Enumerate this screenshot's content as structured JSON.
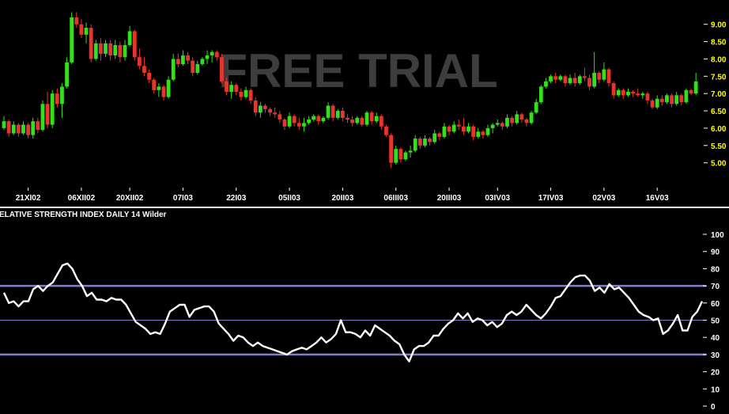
{
  "watermark": "FREE TRIAL",
  "chart_data": [
    {
      "type": "candlestick",
      "panel": "price",
      "ylim": [
        4.75,
        9.35
      ],
      "y_ticks": [
        "5.00",
        "5.50",
        "6.00",
        "6.50",
        "7.00",
        "7.50",
        "8.00",
        "8.50",
        "9.00"
      ],
      "x_ticks": [
        {
          "label": "21XI02",
          "index": 5
        },
        {
          "label": "06XII02",
          "index": 16
        },
        {
          "label": "20XII02",
          "index": 26
        },
        {
          "label": "07I03",
          "index": 37
        },
        {
          "label": "22I03",
          "index": 48
        },
        {
          "label": "05II03",
          "index": 59
        },
        {
          "label": "20II03",
          "index": 70
        },
        {
          "label": "06III03",
          "index": 81
        },
        {
          "label": "20III03",
          "index": 92
        },
        {
          "label": "03IV03",
          "index": 102
        },
        {
          "label": "17IV03",
          "index": 113
        },
        {
          "label": "02V03",
          "index": 124
        },
        {
          "label": "16V03",
          "index": 135
        }
      ],
      "colors": {
        "up": "#33e11a",
        "down": "#e8352c",
        "ticks": "#ffff00",
        "dates": "#ffffff"
      },
      "candles": [
        [
          6.0,
          6.35,
          5.95,
          6.2
        ],
        [
          6.2,
          6.25,
          5.75,
          5.85
        ],
        [
          5.85,
          6.2,
          5.8,
          6.1
        ],
        [
          6.1,
          6.15,
          5.75,
          5.85
        ],
        [
          5.85,
          6.2,
          5.8,
          6.1
        ],
        [
          6.1,
          6.15,
          5.7,
          5.8
        ],
        [
          5.8,
          6.3,
          5.7,
          6.2
        ],
        [
          6.2,
          6.3,
          5.85,
          5.95
        ],
        [
          5.95,
          6.8,
          5.9,
          6.7
        ],
        [
          6.7,
          7.05,
          6.0,
          6.1
        ],
        [
          6.1,
          7.1,
          6.0,
          7.0
        ],
        [
          7.0,
          7.15,
          6.6,
          6.7
        ],
        [
          6.7,
          7.3,
          6.3,
          7.2
        ],
        [
          7.2,
          8.05,
          7.15,
          7.9
        ],
        [
          7.9,
          9.35,
          7.85,
          9.2
        ],
        [
          9.2,
          9.35,
          8.9,
          9.0
        ],
        [
          9.0,
          9.15,
          8.6,
          8.7
        ],
        [
          8.7,
          9.05,
          8.45,
          8.9
        ],
        [
          8.9,
          9.0,
          7.9,
          8.0
        ],
        [
          8.0,
          8.55,
          7.95,
          8.45
        ],
        [
          8.45,
          8.6,
          7.95,
          8.15
        ],
        [
          8.15,
          8.55,
          8.05,
          8.45
        ],
        [
          8.45,
          8.55,
          7.95,
          8.1
        ],
        [
          8.1,
          8.55,
          8.0,
          8.4
        ],
        [
          8.4,
          8.5,
          7.9,
          8.05
        ],
        [
          8.05,
          8.55,
          7.95,
          8.4
        ],
        [
          8.4,
          8.95,
          8.35,
          8.8
        ],
        [
          8.8,
          8.85,
          7.95,
          8.05
        ],
        [
          8.05,
          8.3,
          7.7,
          7.8
        ],
        [
          7.8,
          8.05,
          7.5,
          7.6
        ],
        [
          7.6,
          7.7,
          7.3,
          7.4
        ],
        [
          7.4,
          7.45,
          7.0,
          7.1
        ],
        [
          7.1,
          7.3,
          6.9,
          7.2
        ],
        [
          7.2,
          7.25,
          6.8,
          6.9
        ],
        [
          6.9,
          7.5,
          6.85,
          7.4
        ],
        [
          7.4,
          8.15,
          7.35,
          8.0
        ],
        [
          8.0,
          8.15,
          7.75,
          7.85
        ],
        [
          7.85,
          8.25,
          7.8,
          8.1
        ],
        [
          8.1,
          8.2,
          7.85,
          7.95
        ],
        [
          7.95,
          8.05,
          7.5,
          7.6
        ],
        [
          7.6,
          7.95,
          7.55,
          7.85
        ],
        [
          7.85,
          8.05,
          7.8,
          8.0
        ],
        [
          8.0,
          8.25,
          7.85,
          8.1
        ],
        [
          8.1,
          8.25,
          7.9,
          8.2
        ],
        [
          8.2,
          8.25,
          7.95,
          8.05
        ],
        [
          8.05,
          8.15,
          7.3,
          7.35
        ],
        [
          7.35,
          7.45,
          6.95,
          7.05
        ],
        [
          7.05,
          7.35,
          6.85,
          7.25
        ],
        [
          7.25,
          7.3,
          6.95,
          7.05
        ],
        [
          7.05,
          7.15,
          6.8,
          6.9
        ],
        [
          6.9,
          7.2,
          6.85,
          7.1
        ],
        [
          7.1,
          7.15,
          6.7,
          6.8
        ],
        [
          6.8,
          6.9,
          6.35,
          6.45
        ],
        [
          6.45,
          6.75,
          6.3,
          6.65
        ],
        [
          6.65,
          6.7,
          6.45,
          6.55
        ],
        [
          6.55,
          6.6,
          6.35,
          6.45
        ],
        [
          6.45,
          6.6,
          6.3,
          6.4
        ],
        [
          6.4,
          6.5,
          6.15,
          6.25
        ],
        [
          6.25,
          6.3,
          5.95,
          6.05
        ],
        [
          6.05,
          6.45,
          6.0,
          6.35
        ],
        [
          6.35,
          6.4,
          6.05,
          6.15
        ],
        [
          6.15,
          6.3,
          5.95,
          6.05
        ],
        [
          6.05,
          6.3,
          5.9,
          6.15
        ],
        [
          6.15,
          6.35,
          6.1,
          6.25
        ],
        [
          6.25,
          6.4,
          6.2,
          6.35
        ],
        [
          6.35,
          6.4,
          6.1,
          6.2
        ],
        [
          6.2,
          6.35,
          6.15,
          6.3
        ],
        [
          6.3,
          6.75,
          6.25,
          6.65
        ],
        [
          6.65,
          6.7,
          6.2,
          6.3
        ],
        [
          6.3,
          6.55,
          6.25,
          6.5
        ],
        [
          6.5,
          6.6,
          6.2,
          6.3
        ],
        [
          6.3,
          6.4,
          6.15,
          6.25
        ],
        [
          6.25,
          6.35,
          6.05,
          6.15
        ],
        [
          6.15,
          6.35,
          6.1,
          6.3
        ],
        [
          6.3,
          6.35,
          6.05,
          6.1
        ],
        [
          6.1,
          6.5,
          6.05,
          6.45
        ],
        [
          6.45,
          6.5,
          6.1,
          6.2
        ],
        [
          6.2,
          6.45,
          6.15,
          6.35
        ],
        [
          6.35,
          6.4,
          5.95,
          6.05
        ],
        [
          6.05,
          6.1,
          5.75,
          5.8
        ],
        [
          5.8,
          5.85,
          4.85,
          5.0
        ],
        [
          5.0,
          5.5,
          4.95,
          5.4
        ],
        [
          5.4,
          5.45,
          5.0,
          5.1
        ],
        [
          5.1,
          5.35,
          5.05,
          5.3
        ],
        [
          5.3,
          5.5,
          5.15,
          5.35
        ],
        [
          5.35,
          5.8,
          5.3,
          5.7
        ],
        [
          5.7,
          5.75,
          5.4,
          5.5
        ],
        [
          5.5,
          5.8,
          5.45,
          5.7
        ],
        [
          5.7,
          5.75,
          5.5,
          5.6
        ],
        [
          5.6,
          5.95,
          5.55,
          5.85
        ],
        [
          5.85,
          5.9,
          5.65,
          5.75
        ],
        [
          5.75,
          6.15,
          5.7,
          6.05
        ],
        [
          6.05,
          6.1,
          5.8,
          5.9
        ],
        [
          5.9,
          6.2,
          5.85,
          6.1
        ],
        [
          6.1,
          6.25,
          5.95,
          6.05
        ],
        [
          6.05,
          6.3,
          5.8,
          5.9
        ],
        [
          5.9,
          6.15,
          5.85,
          6.05
        ],
        [
          6.05,
          6.1,
          5.65,
          5.75
        ],
        [
          5.75,
          6.0,
          5.7,
          5.9
        ],
        [
          5.9,
          5.95,
          5.7,
          5.8
        ],
        [
          5.8,
          6.1,
          5.75,
          6.0
        ],
        [
          6.0,
          6.15,
          5.85,
          6.1
        ],
        [
          6.1,
          6.25,
          6.05,
          6.15
        ],
        [
          6.15,
          6.2,
          5.95,
          6.05
        ],
        [
          6.05,
          6.4,
          6.0,
          6.3
        ],
        [
          6.3,
          6.35,
          6.05,
          6.15
        ],
        [
          6.15,
          6.5,
          6.1,
          6.4
        ],
        [
          6.4,
          6.45,
          6.15,
          6.25
        ],
        [
          6.25,
          6.3,
          6.05,
          6.15
        ],
        [
          6.15,
          6.5,
          6.1,
          6.45
        ],
        [
          6.45,
          6.85,
          6.4,
          6.75
        ],
        [
          6.75,
          7.25,
          6.7,
          7.2
        ],
        [
          7.2,
          7.45,
          7.15,
          7.35
        ],
        [
          7.35,
          7.55,
          7.3,
          7.5
        ],
        [
          7.5,
          7.6,
          7.3,
          7.4
        ],
        [
          7.4,
          7.55,
          7.35,
          7.5
        ],
        [
          7.5,
          7.55,
          7.2,
          7.3
        ],
        [
          7.3,
          7.55,
          7.25,
          7.45
        ],
        [
          7.45,
          7.6,
          7.2,
          7.3
        ],
        [
          7.3,
          7.55,
          7.25,
          7.5
        ],
        [
          7.5,
          7.75,
          7.35,
          7.45
        ],
        [
          7.45,
          7.55,
          7.1,
          7.2
        ],
        [
          7.2,
          8.2,
          7.15,
          7.6
        ],
        [
          7.6,
          7.65,
          7.3,
          7.4
        ],
        [
          7.4,
          7.9,
          7.35,
          7.7
        ],
        [
          7.7,
          7.75,
          7.2,
          7.3
        ],
        [
          7.3,
          7.35,
          6.85,
          6.95
        ],
        [
          6.95,
          7.15,
          6.9,
          7.1
        ],
        [
          7.1,
          7.15,
          6.85,
          6.95
        ],
        [
          6.95,
          7.15,
          6.9,
          7.05
        ],
        [
          7.05,
          7.1,
          6.9,
          7.0
        ],
        [
          7.0,
          7.15,
          6.9,
          6.95
        ],
        [
          6.95,
          7.05,
          6.85,
          7.0
        ],
        [
          7.0,
          7.05,
          6.7,
          6.8
        ],
        [
          6.8,
          6.85,
          6.55,
          6.6
        ],
        [
          6.6,
          6.95,
          6.55,
          6.85
        ],
        [
          6.85,
          6.95,
          6.65,
          6.75
        ],
        [
          6.75,
          7.0,
          6.7,
          6.95
        ],
        [
          6.95,
          7.0,
          6.6,
          6.7
        ],
        [
          6.7,
          7.05,
          6.65,
          6.95
        ],
        [
          6.95,
          7.0,
          6.65,
          6.75
        ],
        [
          6.75,
          7.15,
          6.7,
          7.1
        ],
        [
          7.1,
          7.15,
          6.95,
          7.0
        ],
        [
          7.0,
          7.6,
          6.95,
          7.35
        ]
      ]
    },
    {
      "type": "line",
      "panel": "indicator",
      "title": "ELATIVE STRENGTH INDEX DAILY 14 Wilder",
      "ylim": [
        0,
        100
      ],
      "y_ticks": [
        "0",
        "10",
        "20",
        "30",
        "40",
        "50",
        "60",
        "70",
        "80",
        "90",
        "100"
      ],
      "reference_lines": [
        70,
        50,
        30
      ],
      "colors": {
        "line": "#ffffff",
        "reference": "#8080c8",
        "ticks": "#ffffff"
      },
      "series": [
        {
          "values": [
            66,
            60,
            61,
            58,
            61,
            61,
            68,
            70,
            67,
            70,
            72,
            77,
            82,
            83,
            80,
            74,
            70,
            64,
            66,
            62,
            62,
            61,
            63,
            62,
            62,
            59,
            54,
            49,
            47,
            45,
            42,
            43,
            42,
            48,
            55,
            57,
            59,
            59,
            52,
            56,
            57,
            58,
            58,
            55,
            48,
            45,
            42,
            38,
            41,
            40,
            37,
            35,
            37,
            35,
            34,
            33,
            32,
            31,
            30,
            32,
            33,
            34,
            33,
            35,
            37,
            40,
            37,
            39,
            42,
            50,
            43,
            43,
            42,
            40,
            44,
            41,
            47,
            45,
            43,
            41,
            38,
            36,
            30,
            26,
            33,
            35,
            35,
            37,
            41,
            41,
            45,
            48,
            50,
            54,
            51,
            54,
            49,
            51,
            50,
            47,
            49,
            46,
            48,
            53,
            55,
            53,
            55,
            59,
            56,
            53,
            51,
            54,
            58,
            63,
            64,
            68,
            72,
            75,
            76,
            76,
            73,
            67,
            69,
            66,
            71,
            68,
            69,
            66,
            63,
            59,
            55,
            53,
            52,
            50,
            51,
            42,
            44,
            48,
            53,
            44,
            44,
            52,
            55,
            61
          ]
        }
      ]
    }
  ]
}
